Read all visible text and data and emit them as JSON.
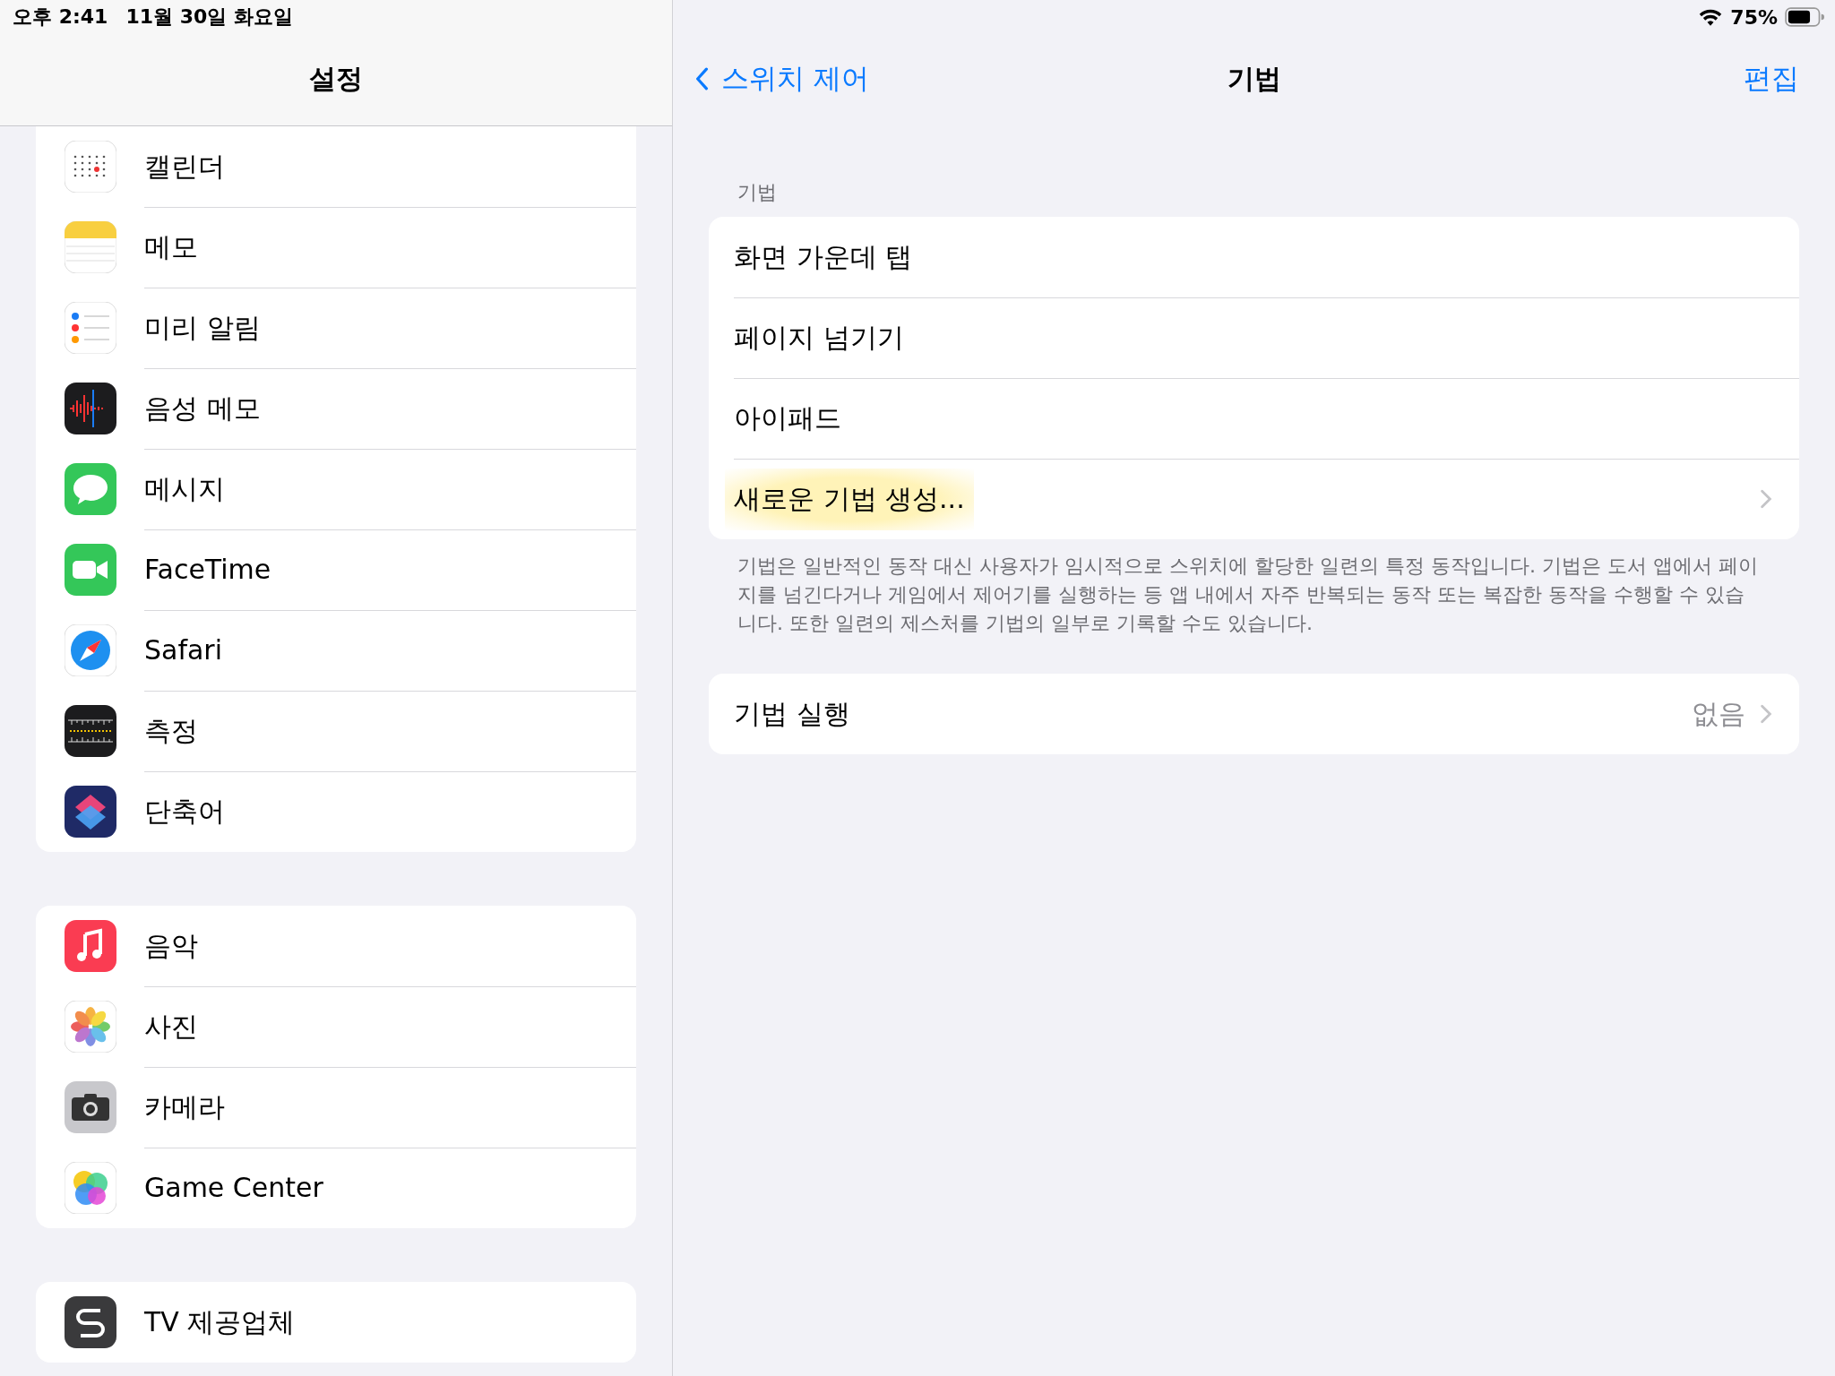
{
  "status_bar": {
    "time": "오후 2:41",
    "date": "11월 30일 화요일",
    "battery": "75%"
  },
  "sidebar": {
    "title": "설정",
    "groups": [
      {
        "items": [
          {
            "label": "캘린더",
            "kind": "calendar"
          },
          {
            "label": "메모",
            "kind": "notes"
          },
          {
            "label": "미리 알림",
            "kind": "reminders"
          },
          {
            "label": "음성 메모",
            "kind": "voice"
          },
          {
            "label": "메시지",
            "kind": "messages"
          },
          {
            "label": "FaceTime",
            "kind": "facetime"
          },
          {
            "label": "Safari",
            "kind": "safari"
          },
          {
            "label": "측정",
            "kind": "measure"
          },
          {
            "label": "단축어",
            "kind": "shortcuts"
          }
        ]
      },
      {
        "items": [
          {
            "label": "음악",
            "kind": "music"
          },
          {
            "label": "사진",
            "kind": "photos"
          },
          {
            "label": "카메라",
            "kind": "camera"
          },
          {
            "label": "Game Center",
            "kind": "gamecenter"
          }
        ]
      },
      {
        "items": [
          {
            "label": "TV 제공업체",
            "kind": "tv"
          }
        ]
      }
    ]
  },
  "detail": {
    "back": "스위치 제어",
    "title": "기법",
    "edit": "편집",
    "section_header": "기법",
    "items": [
      {
        "label": "화면 가운데 탭",
        "highlighted": false,
        "chevron": false
      },
      {
        "label": "페이지 넘기기",
        "highlighted": false,
        "chevron": false
      },
      {
        "label": "아이패드",
        "highlighted": false,
        "chevron": false
      },
      {
        "label": "새로운 기법 생성...",
        "highlighted": true,
        "chevron": true
      }
    ],
    "footer": "기법은 일반적인 동작 대신 사용자가 임시적으로 스위치에 할당한 일련의 특정 동작입니다. 기법은 도서 앱에서 페이지를 넘긴다거나 게임에서 제어기를 실행하는 등 앱 내에서 자주 반복되는 동작 또는 복잡한 동작을 수행할 수 있습니다. 또한 일련의 제스처를 기법의 일부로 기록할 수도 있습니다.",
    "run": {
      "label": "기법 실행",
      "value": "없음"
    }
  }
}
